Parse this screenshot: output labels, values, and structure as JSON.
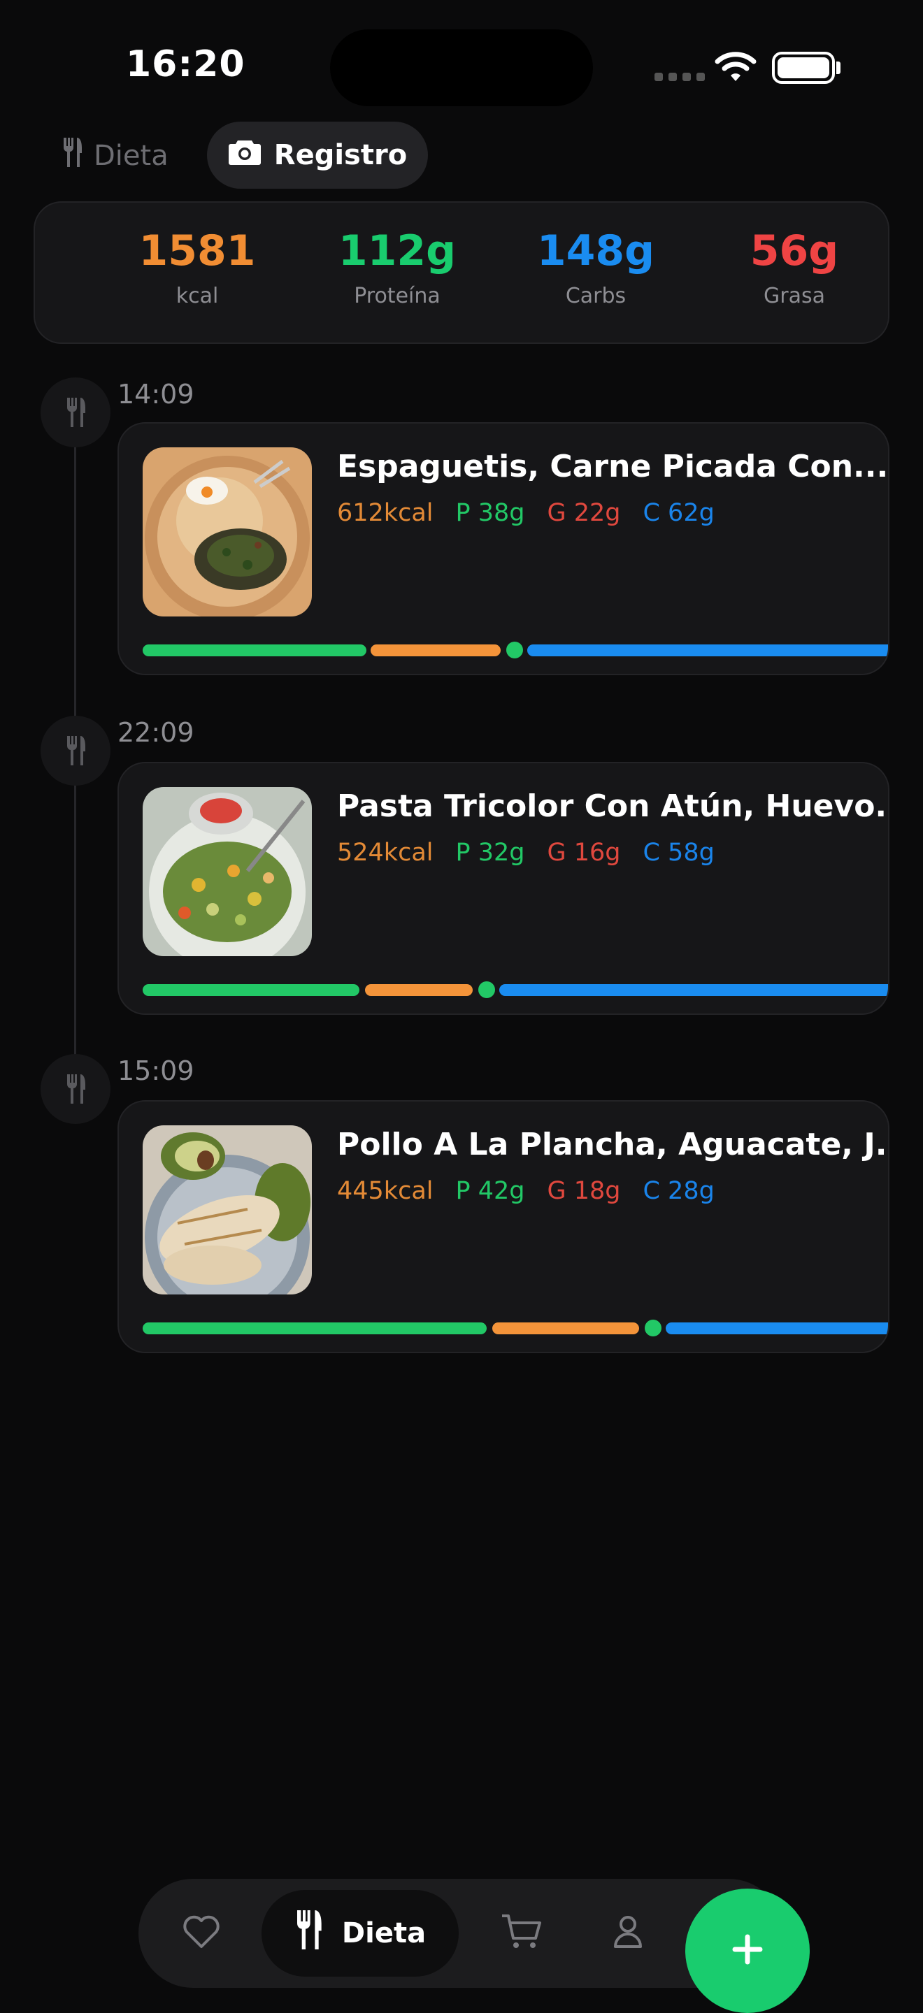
{
  "status_bar": {
    "time": "16:20"
  },
  "top_tabs": [
    {
      "label": "Dieta",
      "icon": "fork-knife-icon",
      "active": false
    },
    {
      "label": "Registro",
      "icon": "camera-icon",
      "active": true
    }
  ],
  "summary": [
    {
      "value": "1581",
      "label": "kcal",
      "color": "#f18d33"
    },
    {
      "value": "112g",
      "label": "Proteína",
      "color": "#19cc6e"
    },
    {
      "value": "148g",
      "label": "Carbs",
      "color": "#1a8cf0"
    },
    {
      "value": "56g",
      "label": "Grasa",
      "color": "#ef4444"
    }
  ],
  "meals": [
    {
      "time": "14:09",
      "title": "Espaguetis, Carne Picada Con...",
      "kcal": "612kcal",
      "p": "P 38g",
      "g": "G 22g",
      "c": "C 62g"
    },
    {
      "time": "22:09",
      "title": "Pasta Tricolor Con Atún, Huevo...",
      "kcal": "524kcal",
      "p": "P 32g",
      "g": "G 16g",
      "c": "C 58g"
    },
    {
      "time": "15:09",
      "title": "Pollo A La Plancha, Aguacate, J...",
      "kcal": "445kcal",
      "p": "P 42g",
      "g": "G 18g",
      "c": "C 28g"
    }
  ],
  "bottom_nav": {
    "items": [
      "heart-icon",
      "fork-knife-icon",
      "cart-icon",
      "person-icon"
    ],
    "active_label": "Dieta",
    "fab_icon": "plus-icon"
  },
  "colors": {
    "protein": "#22c866",
    "fat": "#f4943a",
    "carbs": "#1a8cf0",
    "accent": "#19cc6e"
  }
}
